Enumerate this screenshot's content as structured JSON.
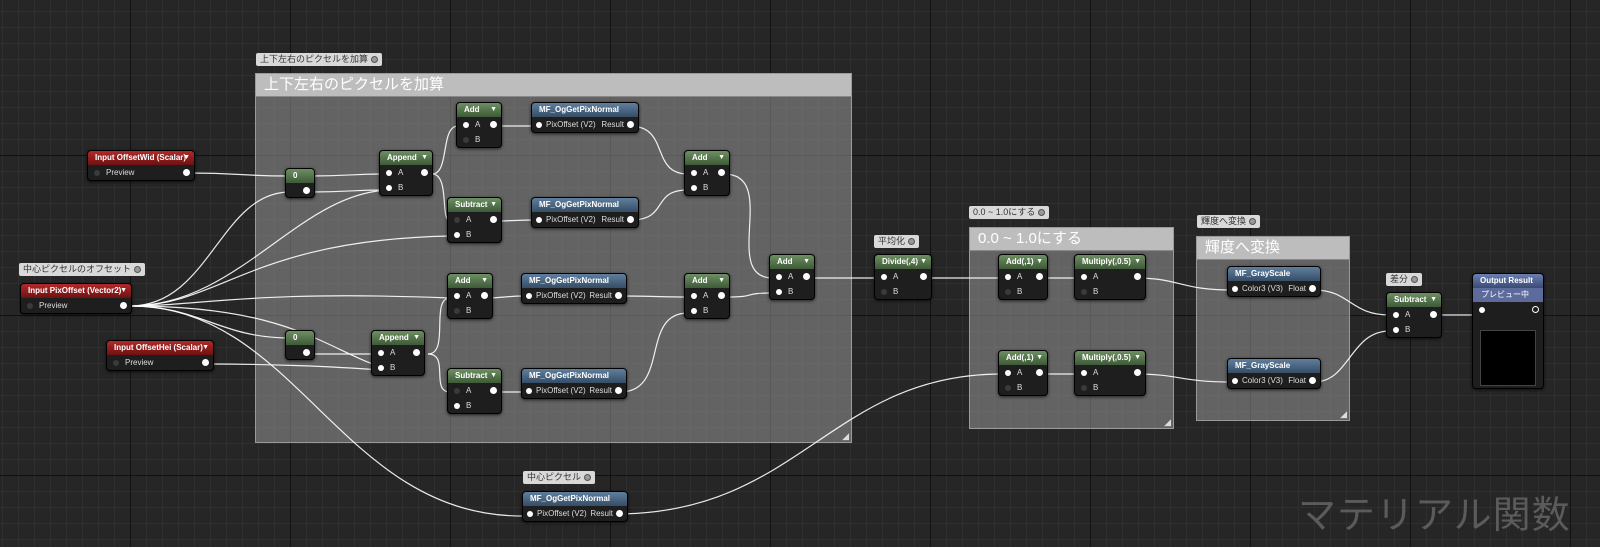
{
  "comments": {
    "add_pixels": {
      "title": "上下左右のピクセルを加算",
      "bubble": "上下左右のピクセルを加算"
    },
    "range": {
      "title": "0.0 ~ 1.0にする",
      "bubble": "0.0 ~ 1.0にする"
    },
    "luminance": {
      "title": "輝度へ変換",
      "bubble": "輝度へ変換"
    },
    "center_bubble": "中心ピクセル",
    "offset_bubble": "中心ピクセルのオフセット",
    "average_bubble": "平均化",
    "diff_bubble": "差分"
  },
  "inputs": {
    "offset_wid": {
      "title": "Input OffsetWid (Scalar)",
      "pin": "Preview"
    },
    "pix_offset": {
      "title": "Input PixOffset (Vector2)",
      "pin": "Preview"
    },
    "offset_hei": {
      "title": "Input OffsetHei (Scalar)",
      "pin": "Preview"
    }
  },
  "labels": {
    "zero": "0",
    "append": "Append",
    "add": "Add",
    "subtract": "Subtract",
    "a": "A",
    "b": "B",
    "mf_normal": "MF_OgGetPixNormal",
    "pix_offset_pin": "PixOffset (V2)",
    "result": "Result",
    "divide": "Divide(,4)",
    "add_one": "Add(,1)",
    "multiply_half": "Multiply(,0.5)",
    "grayscale": "MF_GrayScale",
    "color3": "Color3 (V3)",
    "float": "Float",
    "output_result": "Output Result",
    "preview_on": "プレビュー中"
  },
  "watermark": "マテリアル関数",
  "colors": {
    "comment_bg": "#969696",
    "wire": "#ffffff",
    "scalar_header": "#b02a2a",
    "math_header": "#5b7a52",
    "function_header": "#4b6886",
    "output_header": "#55679a"
  }
}
